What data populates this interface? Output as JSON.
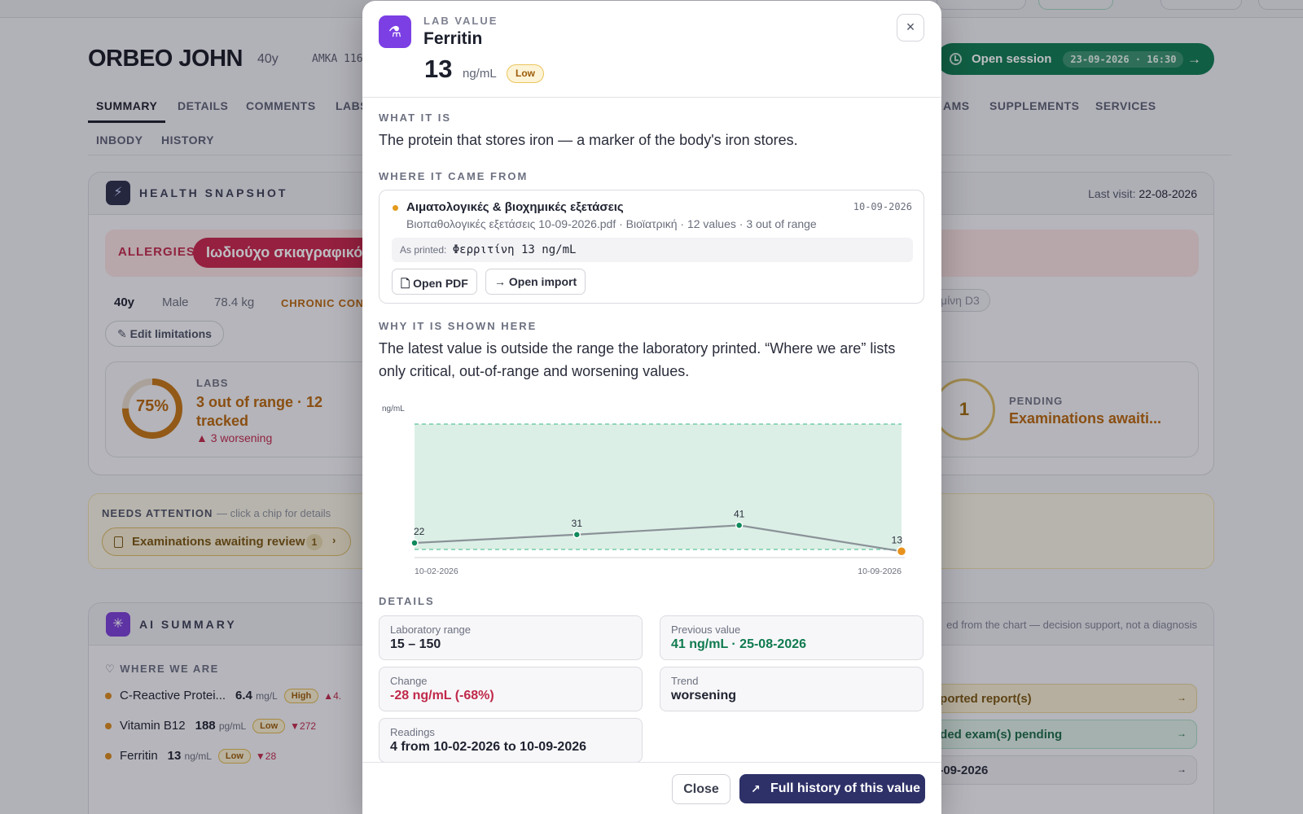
{
  "patient": {
    "name": "ORBEO JOHN",
    "age": "40y",
    "amka": "AMKA 116"
  },
  "session": {
    "label": "Open session",
    "datetime": "23-09-2026 · 16:30"
  },
  "tabs": [
    "SUMMARY",
    "DETAILS",
    "COMMENTS",
    "LABS",
    "AMS",
    "SUPPLEMENTS",
    "SERVICES"
  ],
  "tabs2": [
    "INBODY",
    "HISTORY"
  ],
  "snapshot": {
    "title": "HEALTH SNAPSHOT",
    "last_visit_label": "Last visit:",
    "last_visit": "22-08-2026",
    "allergies_label": "ALLERGIES",
    "allergy_chip": "Ιωδιούχο σκιαγραφικό",
    "age": "40y",
    "sex": "Male",
    "weight": "78.4 kg",
    "chronic": "CHRONIC COND",
    "vit_chip": "μίνη D3",
    "edit_limitations": "Edit limitations",
    "labs": {
      "percent_text": "75%",
      "percent": 0.75,
      "caption": "LABS",
      "main": "3 out of range · 12 tracked",
      "worsening": "▲ 3 worsening"
    },
    "pending": {
      "count": "1",
      "caption": "PENDING",
      "main": "Examinations awaiti..."
    }
  },
  "needs_attention": {
    "label": "NEEDS ATTENTION",
    "sub": "— click a chip for details",
    "chip": "Examinations awaiting review",
    "count": "1"
  },
  "ai_summary": {
    "title": "AI SUMMARY",
    "disclaimer": "ed from the chart — decision support, not a diagnosis",
    "where_label": "WHERE WE ARE",
    "s_label": "s",
    "rows": [
      {
        "name": "C-Reactive Protei...",
        "value": "6.4",
        "unit": "mg/L",
        "flag": "High",
        "delta": "▲4."
      },
      {
        "name": "Vitamin B12",
        "value": "188",
        "unit": "pg/mL",
        "flag": "Low",
        "delta": "▼272"
      },
      {
        "name": "Ferritin",
        "value": "13",
        "unit": "ng/mL",
        "flag": "Low",
        "delta": "▼28"
      }
    ],
    "right_rows": [
      {
        "text": "nported report(s)",
        "color": "#f4ebcf",
        "fg": "#7a5510"
      },
      {
        "text": "nded exam(s) pending",
        "color": "#dceee4",
        "fg": "#1d6a47"
      },
      {
        "text": "3-09-2026",
        "color": "#eaeaee",
        "fg": "#2a2d3b"
      }
    ]
  },
  "modal": {
    "kicker": "LAB VALUE",
    "title": "Ferritin",
    "value": "13",
    "unit": "ng/mL",
    "flag": "Low",
    "close_icon": "close-icon",
    "what_label": "WHAT IT IS",
    "what_text": "The protein that stores iron — a marker of the body's iron stores.",
    "where_label": "WHERE IT CAME FROM",
    "source": {
      "title": "Αιματολογικές & βιοχημικές εξετάσεις",
      "date": "10-09-2026",
      "meta": "Βιοπαθολογικές εξετάσεις 10-09-2026.pdf · Βιοϊατρική · 12 values · 3 out of range",
      "printed_label": "As printed:",
      "printed_value": "Φερριτίνη 13 ng/mL",
      "open_pdf": "Open PDF",
      "open_import": "Open import"
    },
    "why_label": "WHY IT IS SHOWN HERE",
    "why_text": "The latest value is outside the range the laboratory printed. “Where we are” lists only critical, out-of-range and worsening values.",
    "details_label": "DETAILS",
    "details": {
      "range_label": "Laboratory range",
      "range": "15 – 150",
      "prev_label": "Previous value",
      "prev": "41 ng/mL · 25-08-2026",
      "change_label": "Change",
      "change": "-28 ng/mL (-68%)",
      "trend_label": "Trend",
      "trend": "worsening",
      "readings_label": "Readings",
      "readings": "4 from 10-02-2026 to 10-09-2026"
    },
    "btn_close": "Close",
    "btn_history": "Full history of this value"
  },
  "chart_data": {
    "type": "line",
    "ylabel": "ng/mL",
    "x": [
      "10-02-2026",
      "",
      "",
      "10-09-2026"
    ],
    "values": [
      22,
      31,
      41,
      13
    ],
    "reference_range": [
      15,
      150
    ],
    "ylim": [
      8,
      150
    ],
    "x_tick_labels": [
      "10-02-2026",
      "10-09-2026"
    ],
    "colors": {
      "line": "#8a9298",
      "normal": "#0f8a5c",
      "latest": "#e8921d",
      "band": "#dcefe6",
      "band_edge": "#5ec49a"
    }
  }
}
